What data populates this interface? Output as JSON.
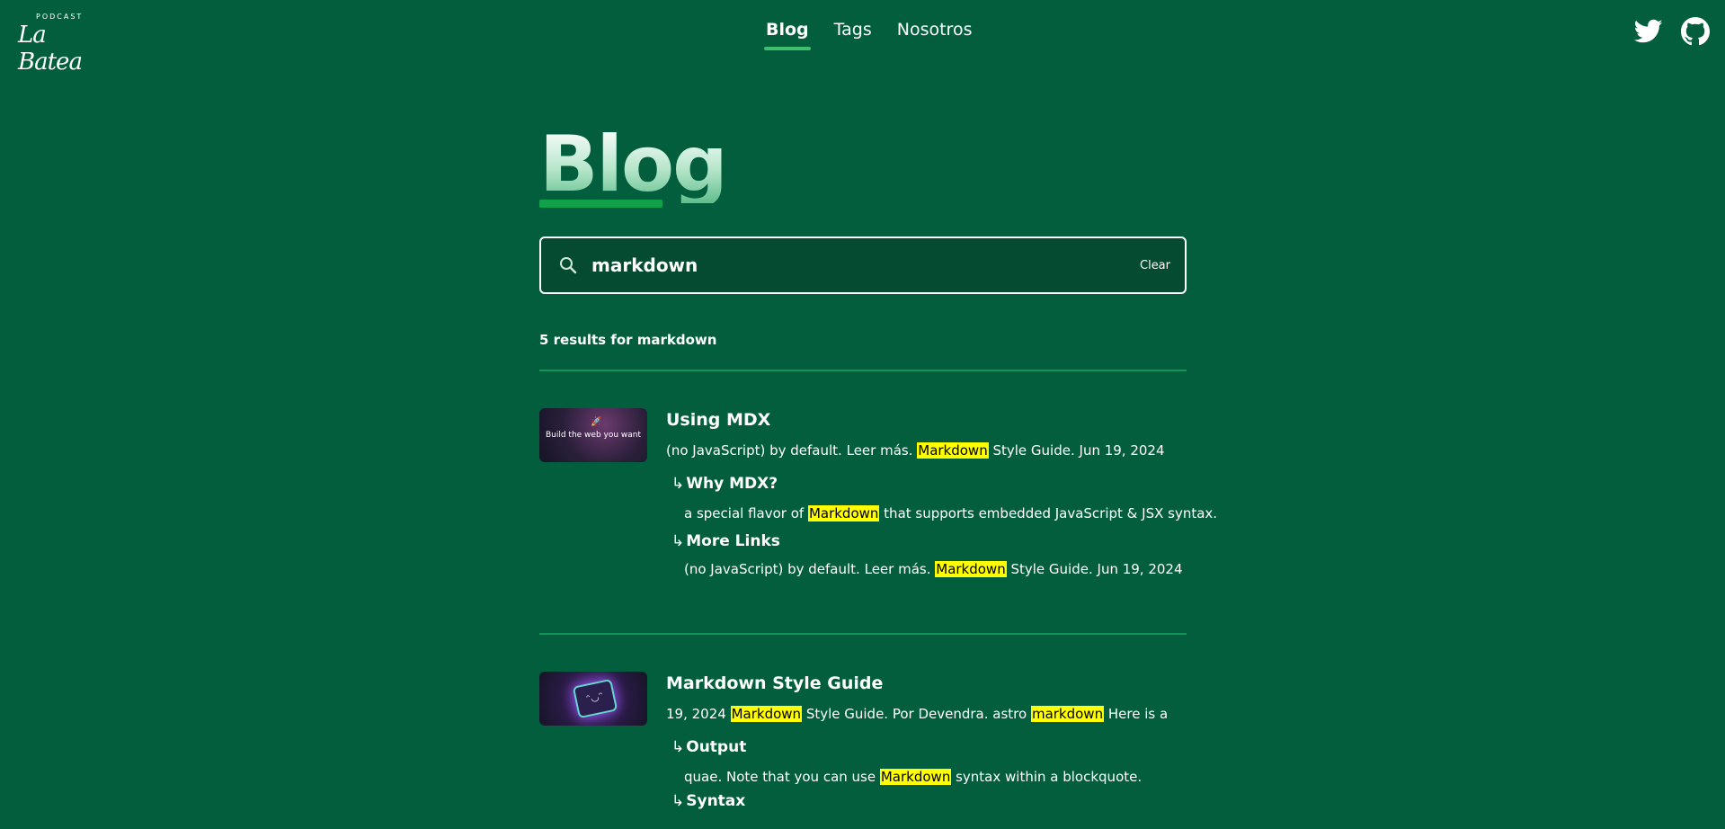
{
  "header": {
    "logo_small": "PODCAST",
    "logo_big": "La Batea",
    "nav": [
      {
        "label": "Blog",
        "active": true
      },
      {
        "label": "Tags",
        "active": false
      },
      {
        "label": "Nosotros",
        "active": false
      }
    ],
    "social": [
      "twitter-icon",
      "github-icon"
    ]
  },
  "page_title": "Blog",
  "search": {
    "value": "markdown",
    "clear_label": "Clear",
    "icon": "search-icon"
  },
  "results_summary": {
    "prefix": "5 results for",
    "query": "markdown"
  },
  "results": [
    {
      "title": "Using MDX",
      "thumb_text": "Build the web you want",
      "excerpt": {
        "before": "(no JavaScript) by default. Leer más. ",
        "match": "Markdown",
        "after": " Style Guide. Jun 19, 2024"
      },
      "sections": [
        {
          "arrow": "↳",
          "heading": "Why MDX?",
          "before": "a special flavor of ",
          "match": "Markdown",
          "after": " that supports embedded JavaScript & JSX syntax."
        },
        {
          "arrow": "↳",
          "heading": "More Links",
          "before": "(no JavaScript) by default. Leer más. ",
          "match": "Markdown",
          "after": " Style Guide. Jun 19, 2024"
        }
      ]
    },
    {
      "title": "Markdown Style Guide",
      "thumb_text": "",
      "excerpt": {
        "before": "19, 2024 ",
        "match": "Markdown",
        "middle": " Style Guide. Por Devendra. astro ",
        "match2": "markdown",
        "after": " Here is a"
      },
      "sections": [
        {
          "arrow": "↳",
          "heading": "Output",
          "before": "quae. Note that you can use ",
          "match": "Markdown",
          "after": " syntax within a blockquote."
        },
        {
          "arrow": "↳",
          "heading": "Syntax",
          "before": "",
          "match": "",
          "after": ""
        }
      ]
    }
  ],
  "colors": {
    "background": "#025e3d",
    "accent": "#11a14a",
    "highlight": "#ffff00"
  }
}
